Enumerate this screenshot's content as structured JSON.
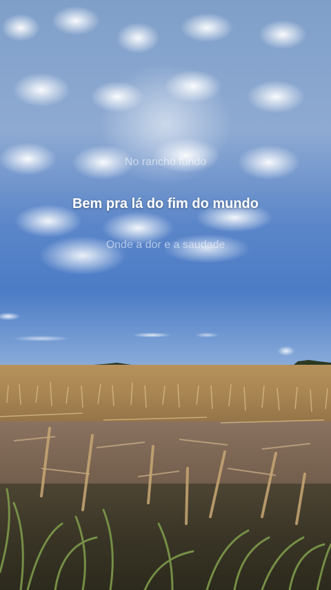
{
  "lyrics": {
    "previous_line": "No rancho fundo",
    "current_line": "Bem pra lá do fim do mundo",
    "next_line": "Onde a dor e a saudade"
  },
  "scene": {
    "sky_color": "#5b86c9",
    "cloud_color": "#ffffff",
    "field_color": "#a98652",
    "foliage_color": "#6f8a4a"
  }
}
